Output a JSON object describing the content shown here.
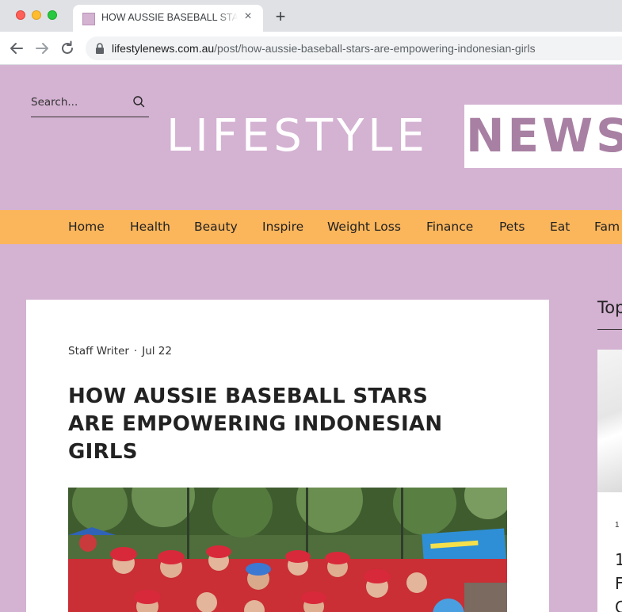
{
  "browser": {
    "tab_title": "HOW AUSSIE BASEBALL STARS ARE EMPOWERING INDONESIAN GIRLS",
    "new_tab": "+",
    "close": "×",
    "url_domain": "lifestylenews.com.au",
    "url_path": "/post/how-aussie-baseball-stars-are-empowering-indonesian-girls"
  },
  "header": {
    "search_placeholder": "Search...",
    "logo_part1": "LIFESTYLE",
    "logo_part2": "NEWS"
  },
  "nav": {
    "items": [
      "Home",
      "Health",
      "Beauty",
      "Inspire",
      "Weight Loss",
      "Finance",
      "Pets",
      "Eat",
      "Fam"
    ]
  },
  "post": {
    "author": "Staff Writer",
    "separator": "·",
    "date": "Jul 22",
    "title": "HOW AUSSIE BASEBALL STARS ARE EMPOWERING INDONESIAN GIRLS"
  },
  "sidebar": {
    "heading": "Top",
    "small": "1",
    "lines": [
      "1",
      "F",
      "C"
    ]
  },
  "colors": {
    "page_bg": "#d4b2d2",
    "nav_bg": "#fbb55b",
    "logo_news": "#a880a3"
  }
}
